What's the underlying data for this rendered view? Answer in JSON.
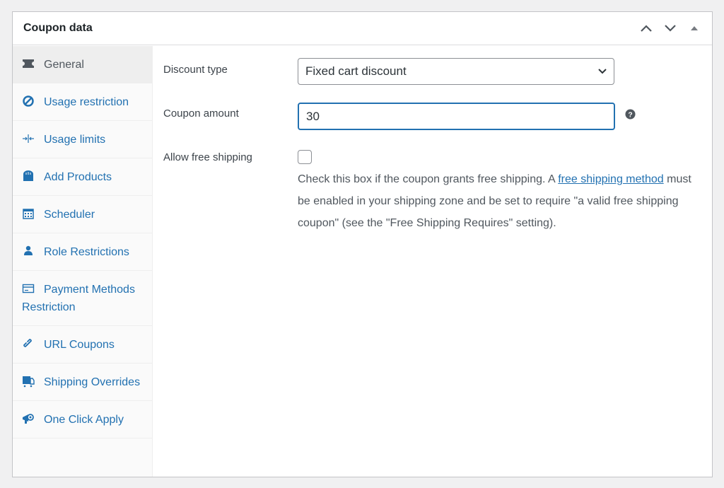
{
  "header": {
    "title": "Coupon data",
    "actions": [
      {
        "name": "move-up-button",
        "icon": "chevron-up-icon"
      },
      {
        "name": "move-down-button",
        "icon": "chevron-down-icon"
      },
      {
        "name": "toggle-panel-button",
        "icon": "triangle-up-icon"
      }
    ]
  },
  "sidebar": {
    "items": [
      {
        "label": "General",
        "icon": "ticket-icon",
        "active": true
      },
      {
        "label": "Usage restriction",
        "icon": "block-icon",
        "active": false
      },
      {
        "label": "Usage limits",
        "icon": "arrows-inward-icon",
        "active": false
      },
      {
        "label": "Add Products",
        "icon": "shopping-bag-icon",
        "active": false
      },
      {
        "label": "Scheduler",
        "icon": "calendar-icon",
        "active": false
      },
      {
        "label": "Role Restrictions",
        "icon": "user-icon",
        "active": false
      },
      {
        "label": "Payment Methods Restriction",
        "icon": "credit-card-icon",
        "active": false
      },
      {
        "label": "URL Coupons",
        "icon": "link-icon",
        "active": false
      },
      {
        "label": "Shipping Overrides",
        "icon": "truck-icon",
        "active": false
      },
      {
        "label": "One Click Apply",
        "icon": "megaphone-icon",
        "active": false
      }
    ]
  },
  "form": {
    "discount_type": {
      "label": "Discount type",
      "value": "Fixed cart discount"
    },
    "coupon_amount": {
      "label": "Coupon amount",
      "value": "30"
    },
    "free_shipping": {
      "label": "Allow free shipping",
      "checked": false,
      "desc_before": "Check this box if the coupon grants free shipping. A ",
      "link_text": "free shipping method",
      "desc_after": " must be enabled in your shipping zone and be set to require \"a valid free shipping coupon\" (see the \"Free Shipping Requires\" setting)."
    }
  },
  "colors": {
    "accent": "#2271b1",
    "text": "#3c434a",
    "background": "#f0f0f1"
  }
}
